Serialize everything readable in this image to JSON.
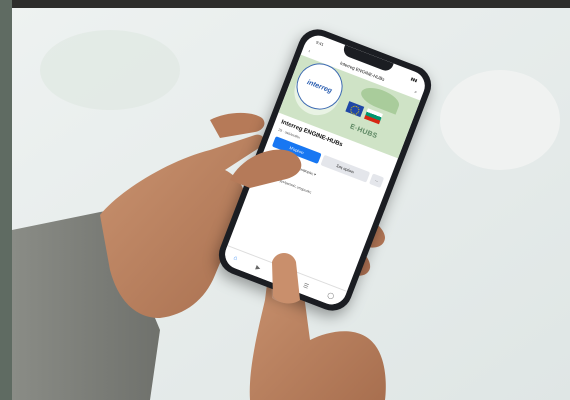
{
  "status_bar": {
    "time": "9:41",
    "signal": "▮▮▮"
  },
  "header": {
    "back_icon": "back-arrow-icon",
    "title": "Interreg ENGINE-HUBs",
    "search_icon": "search-icon"
  },
  "cover": {
    "logo_text": "interreg",
    "hubs_text": "E·HUBS"
  },
  "page": {
    "name": "Interreg ENGINE-HUBs",
    "meta": "29 · ακόλουθοι",
    "follow_label": "Μ'αρέσει",
    "message_label": "Σας αρέσει",
    "more_label": "···"
  },
  "tabs": [
    {
      "label": "Δημοσιεύσεις"
    },
    {
      "label": "Πληροφορίες ▾"
    }
  ],
  "section": {
    "title": "Λεπτομέρειες",
    "info": "Σελίδα · Επαγγελματικές υπηρεσίες"
  },
  "navbar": {
    "items": [
      "⌂",
      "▶",
      "◎",
      "☰",
      "◯"
    ]
  }
}
